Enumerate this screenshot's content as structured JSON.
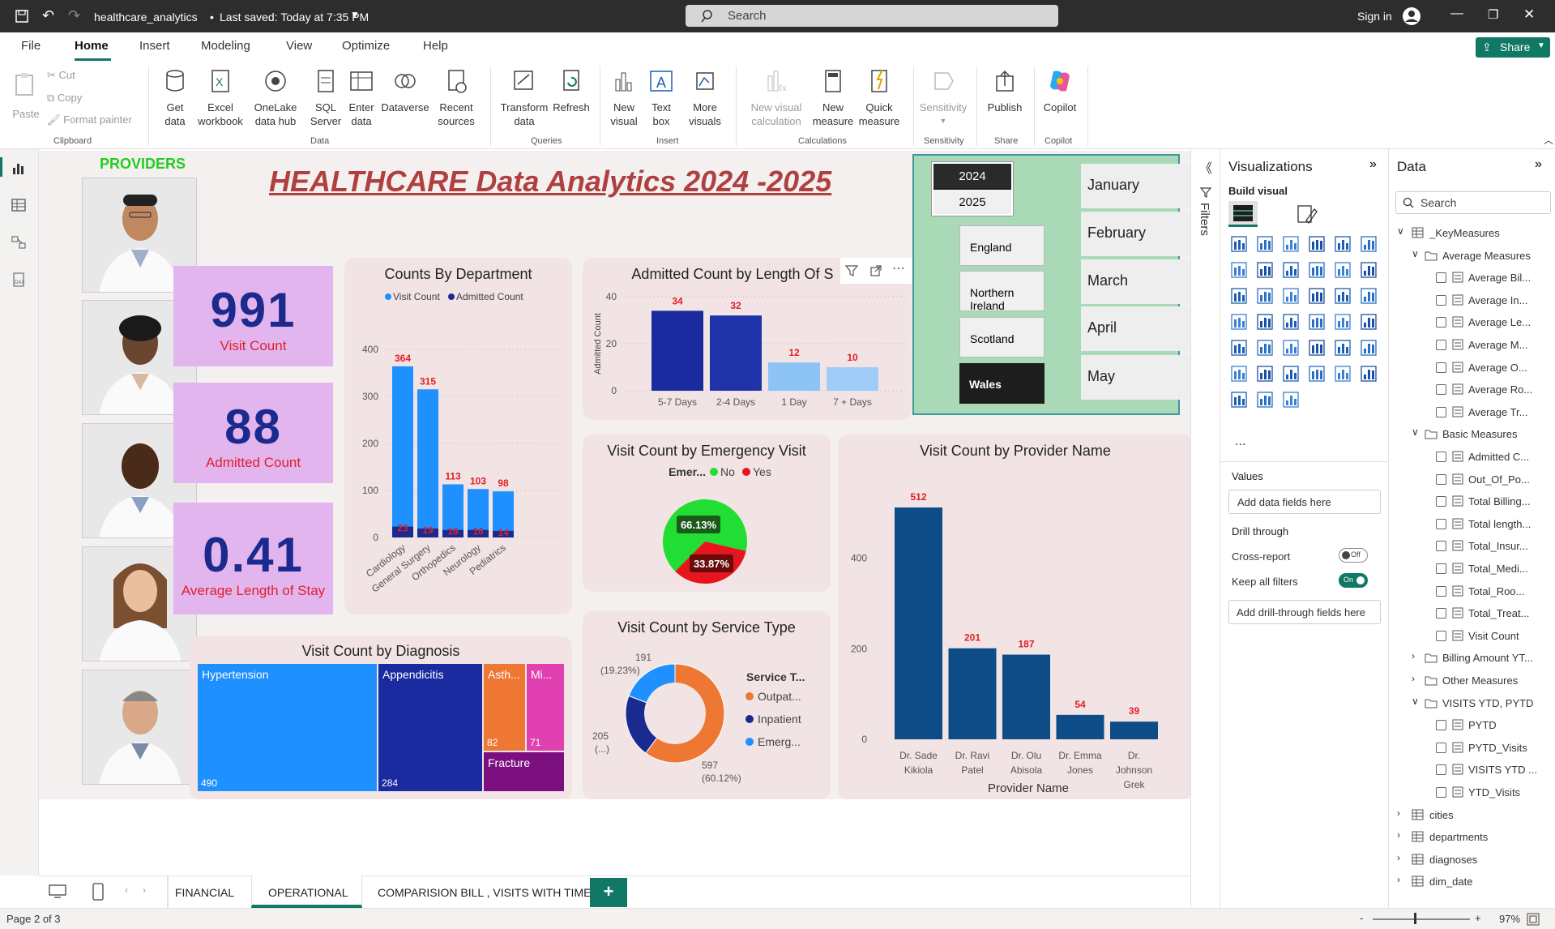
{
  "titlebar": {
    "filename": "healthcare_analytics",
    "saved": "Last saved: Today at 7:35 PM",
    "search_placeholder": "Search",
    "signin": "Sign in"
  },
  "menu": [
    "File",
    "Home",
    "Insert",
    "Modeling",
    "View",
    "Optimize",
    "Help"
  ],
  "share_label": "Share",
  "ribbon": {
    "paste": "Paste",
    "cut": "Cut",
    "copy": "Copy",
    "format_painter": "Format painter",
    "get_data": "Get data",
    "excel": "Excel workbook",
    "onelake": "OneLake data hub",
    "sql": "SQL Server",
    "enter_data": "Enter data",
    "dataverse": "Dataverse",
    "recent": "Recent sources",
    "transform": "Transform data",
    "refresh": "Refresh",
    "new_visual": "New visual",
    "text_box": "Text box",
    "more_visuals": "More visuals",
    "new_visual_calc": "New visual calculation",
    "new_measure": "New measure",
    "quick_measure": "Quick measure",
    "sensitivity": "Sensitivity",
    "publish": "Publish",
    "copilot": "Copilot",
    "groups": {
      "clipboard": "Clipboard",
      "data": "Data",
      "queries": "Queries",
      "insert": "Insert",
      "calculations": "Calculations",
      "sensitivity": "Sensitivity",
      "share": "Share",
      "copilot": "Copilot"
    }
  },
  "report": {
    "providers_label": "PROVIDERS",
    "title": "HEALTHCARE Data Analytics 2024 -2025",
    "kpis": [
      {
        "value": "991",
        "label": "Visit Count"
      },
      {
        "value": "88",
        "label": "Admitted Count"
      },
      {
        "value": "0.41",
        "label": "Average Length of Stay"
      }
    ],
    "years": [
      "2024",
      "2025"
    ],
    "regions": [
      "England",
      "Northern Ireland",
      "Scotland",
      "Wales"
    ],
    "months": [
      "January",
      "February",
      "March",
      "April",
      "May"
    ]
  },
  "chart_data": [
    {
      "id": "dept",
      "type": "bar",
      "title": "Counts By Department",
      "categories": [
        "Cardiology",
        "General Surgery",
        "Orthopedics",
        "Neurology",
        "Pediatrics"
      ],
      "series": [
        {
          "name": "Visit Count",
          "values": [
            364,
            315,
            113,
            103,
            98
          ]
        },
        {
          "name": "Admitted Count",
          "values": [
            23,
            19,
            16,
            16,
            14
          ]
        }
      ],
      "ylim": [
        0,
        400
      ],
      "yticks": [
        "0",
        "100",
        "200",
        "300",
        "400"
      ],
      "colors": [
        "#1e90ff",
        "#1a2a8f"
      ]
    },
    {
      "id": "los",
      "type": "bar",
      "title": "Admitted Count by Length Of S",
      "categories": [
        "5-7 Days",
        "2-4 Days",
        "1 Day",
        "7 + Days"
      ],
      "values": [
        34,
        32,
        12,
        10
      ],
      "ylabel": "Admitted Count",
      "ylim": [
        0,
        40
      ],
      "yticks": [
        "0",
        "20",
        "40"
      ],
      "colors": [
        "#1a2a9f",
        "#1e33a8",
        "#8ec4f5",
        "#9fcdf7"
      ]
    },
    {
      "id": "emerg",
      "type": "pie",
      "title": "Visit Count by Emergency Visit",
      "legend_title": "Emer...",
      "labels": [
        "No",
        "Yes"
      ],
      "values": [
        66.13,
        33.87
      ],
      "display": [
        "66.13%",
        "33.87%"
      ],
      "colors": [
        "#22dd33",
        "#e8141e"
      ]
    },
    {
      "id": "service",
      "type": "pie",
      "title": "Visit Count by Service Type",
      "legend_title": "Service T...",
      "labels": [
        "Outpat...",
        "Inpatient",
        "Emerg..."
      ],
      "values": [
        597,
        205,
        191
      ],
      "display": [
        "597",
        "205",
        "191"
      ],
      "pct": [
        "(60.12%)",
        "(...)",
        "(19.23%)"
      ],
      "colors": [
        "#ee7733",
        "#1a2a8f",
        "#1e90ff"
      ]
    },
    {
      "id": "provider",
      "type": "bar",
      "title": "Visit Count by Provider Name",
      "xlabel": "Provider Name",
      "categories": [
        "Dr. Sade Kikiola",
        "Dr. Ravi Patel",
        "Dr. Olu Abisola",
        "Dr. Emma Jones",
        "Dr. Johnson Grek"
      ],
      "values": [
        512,
        201,
        187,
        54,
        39
      ],
      "ylim": [
        0,
        512
      ],
      "yticks": [
        "0",
        "200",
        "400"
      ],
      "color": "#0d4c86"
    },
    {
      "id": "diagnosis",
      "type": "treemap",
      "title": "Visit Count by Diagnosis",
      "labels": [
        "Hypertension",
        "Appendicitis",
        "Asth...",
        "Mi...",
        "Fracture"
      ],
      "values": [
        490,
        284,
        82,
        71,
        null
      ],
      "display": [
        "490",
        "284",
        "82",
        "71",
        ""
      ],
      "colors": [
        "#1e90ff",
        "#1a2a9f",
        "#ee7733",
        "#e040b0",
        "#7b0f7f"
      ]
    }
  ],
  "viz_pane": {
    "title": "Visualizations",
    "build": "Build visual",
    "values": "Values",
    "add_fields": "Add data fields here",
    "drill": "Drill through",
    "cross": "Cross-report",
    "cross_state": "Off",
    "keep": "Keep all filters",
    "keep_state": "On",
    "add_drill": "Add drill-through fields here",
    "more": "..."
  },
  "filters_label": "Filters",
  "data_pane": {
    "title": "Data",
    "search": "Search",
    "items": [
      {
        "type": "table",
        "label": "_KeyMeasures",
        "indent": 0,
        "open": true
      },
      {
        "type": "folder",
        "label": "Average Measures",
        "indent": 1,
        "open": true
      },
      {
        "type": "field",
        "label": "Average Bil..."
      },
      {
        "type": "field",
        "label": "Average In..."
      },
      {
        "type": "field",
        "label": "Average Le..."
      },
      {
        "type": "field",
        "label": "Average M..."
      },
      {
        "type": "field",
        "label": "Average O..."
      },
      {
        "type": "field",
        "label": "Average Ro..."
      },
      {
        "type": "field",
        "label": "Average Tr..."
      },
      {
        "type": "folder",
        "label": "Basic Measures",
        "indent": 1,
        "open": true
      },
      {
        "type": "field",
        "label": "Admitted C..."
      },
      {
        "type": "field",
        "label": "Out_Of_Po..."
      },
      {
        "type": "field",
        "label": "Total Billing..."
      },
      {
        "type": "field",
        "label": "Total length..."
      },
      {
        "type": "field",
        "label": "Total_Insur..."
      },
      {
        "type": "field",
        "label": "Total_Medi..."
      },
      {
        "type": "field",
        "label": "Total_Roo..."
      },
      {
        "type": "field",
        "label": "Total_Treat..."
      },
      {
        "type": "field",
        "label": "Visit Count"
      },
      {
        "type": "folder",
        "label": "Billing Amount YT...",
        "indent": 1,
        "open": false
      },
      {
        "type": "folder",
        "label": "Other Measures",
        "indent": 1,
        "open": false
      },
      {
        "type": "folder",
        "label": "VISITS YTD, PYTD",
        "indent": 1,
        "open": true
      },
      {
        "type": "field",
        "label": "PYTD"
      },
      {
        "type": "field",
        "label": "PYTD_Visits"
      },
      {
        "type": "field",
        "label": "VISITS YTD ..."
      },
      {
        "type": "field",
        "label": "YTD_Visits"
      },
      {
        "type": "table",
        "label": "cities",
        "indent": 0,
        "open": false
      },
      {
        "type": "table",
        "label": "departments",
        "indent": 0,
        "open": false
      },
      {
        "type": "table",
        "label": "diagnoses",
        "indent": 0,
        "open": false
      },
      {
        "type": "table",
        "label": "dim_date",
        "indent": 0,
        "open": false
      }
    ]
  },
  "tabs": [
    "FINANCIAL",
    "OPERATIONAL",
    "COMPARISION BILL , VISITS WITH TIME"
  ],
  "add_tab": "+",
  "status": {
    "page": "Page 2 of 3",
    "zoom": "97%"
  }
}
